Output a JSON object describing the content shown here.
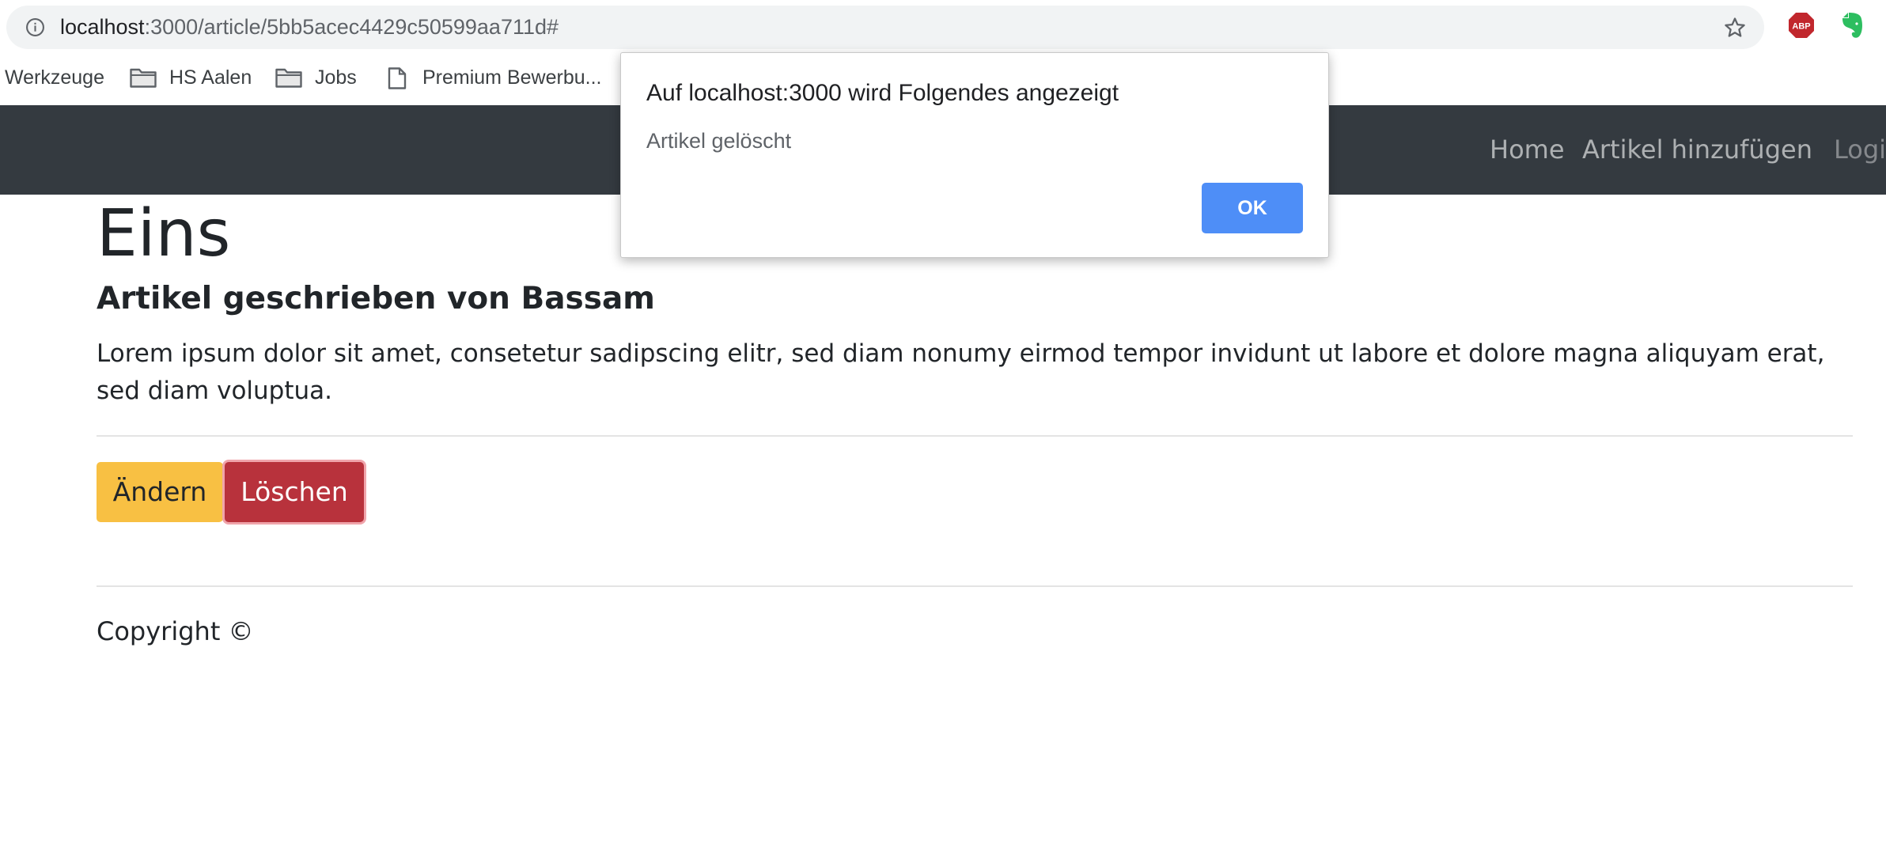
{
  "browser": {
    "url_host": "localhost",
    "url_path": ":3000/article/5bb5acec4429c50599aa711d#",
    "bookmarks": [
      {
        "label": "Werkzeuge",
        "icon": "none"
      },
      {
        "label": "HS Aalen",
        "icon": "folder-icon"
      },
      {
        "label": "Jobs",
        "icon": "folder-icon"
      },
      {
        "label": "Premium Bewerbu...",
        "icon": "page-icon"
      }
    ],
    "extensions": {
      "abp_label": "ABP"
    }
  },
  "navbar": {
    "links": [
      {
        "label": "Home"
      },
      {
        "label": "Artikel hinzufügen"
      },
      {
        "label": "Logi"
      }
    ]
  },
  "article": {
    "title": "Eins",
    "subtitle": "Artikel geschrieben von Bassam",
    "body": "Lorem ipsum dolor sit amet, consetetur sadipscing elitr, sed diam nonumy eirmod tempor invidunt ut labore et dolore magna aliquyam erat, sed diam voluptua.",
    "edit_label": "Ändern",
    "delete_label": "Löschen"
  },
  "footer": {
    "text": "Copyright ©"
  },
  "dialog": {
    "title": "Auf localhost:3000 wird Folgendes angezeigt",
    "message": "Artikel gelöscht",
    "ok_label": "OK"
  },
  "colors": {
    "navbar_bg": "#343a40",
    "edit_button": "#f8c043",
    "delete_button": "#b8323c",
    "dialog_ok": "#4e8ef7"
  }
}
